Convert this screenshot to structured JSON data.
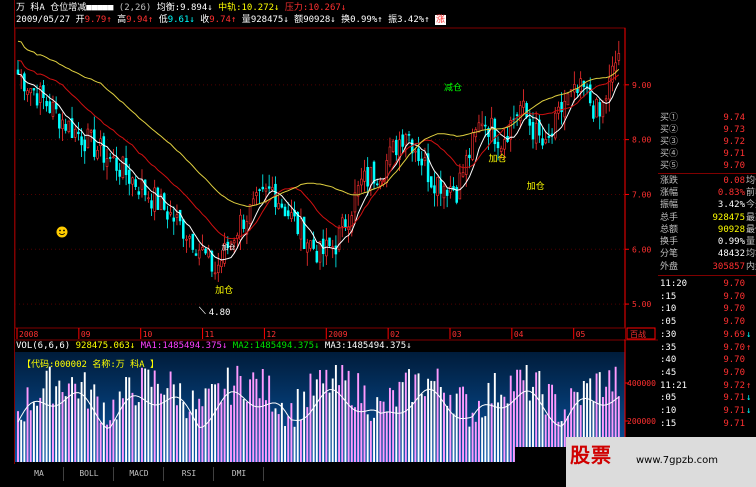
{
  "header": {
    "stock_name": "万  科A",
    "indicator_name": "仓位增减",
    "indicator_boxes": "■■■■■",
    "indicator_params": "(2,26)",
    "avg_label": "均衡:",
    "avg_value": "9.894",
    "mid_label": "中轨:",
    "mid_value": "10.272",
    "pressure_label": "压力:",
    "pressure_value": "10.267",
    "date": "2009/05/27",
    "open_label": "开",
    "open_value": "9.79",
    "high_label": "高",
    "high_value": "9.94",
    "low_label": "低",
    "low_value": "9.61",
    "close_label": "收",
    "close_value": "9.74",
    "vol_label": "量",
    "vol_value": "928475",
    "amount_label": "额",
    "amount_value": "90928",
    "turnover_label": "换",
    "turnover_value": "0.99%",
    "amplitude_label": "振",
    "amplitude_value": "3.42%",
    "rise_label": "涨"
  },
  "chart_data": {
    "type": "candlestick",
    "price_axis": [
      "9.00",
      "8.00",
      "7.00",
      "6.00",
      "5.00"
    ],
    "ylim": [
      4.6,
      10.0
    ],
    "date_axis": [
      "2008",
      "09",
      "10",
      "11",
      "12",
      "2009",
      "02",
      "03",
      "04",
      "05"
    ],
    "annotations": [
      {
        "text": "加仓"
      },
      {
        "text": "加仓"
      },
      {
        "text": "减仓"
      },
      {
        "text": "加仓"
      },
      {
        "text": "4.80"
      }
    ],
    "overlay_tag": "加仓",
    "volume_axis": [
      "400000",
      "200000"
    ],
    "volume": {
      "title": "VOL(6,6,6)",
      "vol_value": "928475.063",
      "ma1_label": "MA1:",
      "ma1_value": "1485494.375",
      "ma2_label": "MA2:",
      "ma2_value": "1485494.375",
      "ma3_label": "MA3:",
      "ma3_value": "1485494.375"
    },
    "code_label": "【代码:000002 名称:万  科A 】",
    "last_price_box": "百战"
  },
  "order_book": {
    "bids": [
      {
        "label": "买①",
        "price": "9.74"
      },
      {
        "label": "买②",
        "price": "9.73"
      },
      {
        "label": "买③",
        "price": "9.72"
      },
      {
        "label": "买④",
        "price": "9.71"
      },
      {
        "label": "买⑤",
        "price": "9.70"
      }
    ]
  },
  "stats": [
    {
      "label": "涨跌",
      "value": "0.08",
      "extra": "均价"
    },
    {
      "label": "涨幅",
      "value": "0.83%",
      "extra": "前收"
    },
    {
      "label": "振幅",
      "value": "3.42%",
      "extra": "今开"
    },
    {
      "label": "总手",
      "value": "928475",
      "extra": "最高"
    },
    {
      "label": "总额",
      "value": "90928",
      "extra": "最低"
    },
    {
      "label": "换手",
      "value": "0.99%",
      "extra": "量比"
    },
    {
      "label": "分笔",
      "value": "48432",
      "extra": "均笔"
    }
  ],
  "outer": {
    "label": "外盘",
    "value": "305857",
    "extra": "内盘"
  },
  "ticks": [
    {
      "time": "11:20",
      "price": "9.70",
      "arrow": ""
    },
    {
      "time": ":15",
      "price": "9.70",
      "arrow": ""
    },
    {
      "time": ":10",
      "price": "9.70",
      "arrow": ""
    },
    {
      "time": ":05",
      "price": "9.70",
      "arrow": ""
    },
    {
      "time": ":30",
      "price": "9.69",
      "arrow": "↓"
    },
    {
      "time": ":35",
      "price": "9.70",
      "arrow": "↑"
    },
    {
      "time": ":40",
      "price": "9.70",
      "arrow": ""
    },
    {
      "time": ":45",
      "price": "9.70",
      "arrow": ""
    },
    {
      "time": "11:21",
      "price": "9.72",
      "arrow": "↑"
    },
    {
      "time": ":05",
      "price": "9.71",
      "arrow": "↓"
    },
    {
      "time": ":10",
      "price": "9.71",
      "arrow": "↓"
    },
    {
      "time": ":15",
      "price": "9.71",
      "arrow": ""
    }
  ],
  "tabs": [
    "MA",
    "BOLL",
    "MACD",
    "RSI",
    "DMI"
  ],
  "watermark": {
    "logo": "股票",
    "url": "www.7gpzb.com"
  }
}
